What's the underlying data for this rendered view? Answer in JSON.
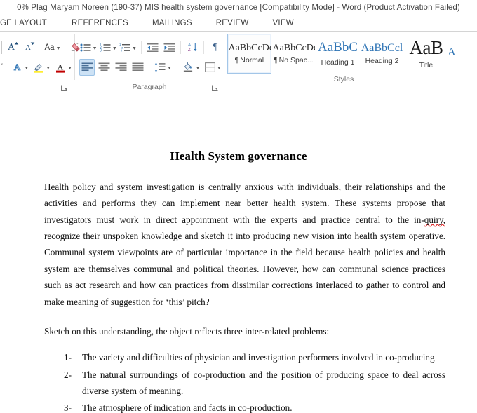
{
  "titlebar": {
    "text": "0% Plag Maryam Noreen (190-37) MIS health system governance [Compatibility Mode] - Word (Product Activation Failed)"
  },
  "tabs": [
    {
      "label": "GE LAYOUT",
      "name": "tab-page-layout"
    },
    {
      "label": "REFERENCES",
      "name": "tab-references"
    },
    {
      "label": "MAILINGS",
      "name": "tab-mailings"
    },
    {
      "label": "REVIEW",
      "name": "tab-review"
    },
    {
      "label": "VIEW",
      "name": "tab-view"
    }
  ],
  "ribbon": {
    "font_group": {
      "label": "",
      "buttons": [
        {
          "name": "grow-font-button",
          "tooltip": "Grow Font"
        },
        {
          "name": "shrink-font-button",
          "tooltip": "Shrink Font"
        },
        {
          "name": "change-case-button",
          "label": "Aa"
        },
        {
          "name": "clear-formatting-button",
          "tooltip": "Clear All Formatting"
        },
        {
          "name": "text-effects-button",
          "tooltip": "Text Effects and Typography"
        },
        {
          "name": "text-highlight-color-button",
          "tooltip": "Text Highlight Color"
        },
        {
          "name": "font-color-button",
          "tooltip": "Font Color"
        }
      ]
    },
    "paragraph_group": {
      "label": "Paragraph",
      "buttons": [
        {
          "name": "bullets-button",
          "tooltip": "Bullets"
        },
        {
          "name": "numbering-button",
          "tooltip": "Numbering"
        },
        {
          "name": "multilevel-list-button",
          "tooltip": "Multilevel List"
        },
        {
          "name": "decrease-indent-button",
          "tooltip": "Decrease Indent"
        },
        {
          "name": "increase-indent-button",
          "tooltip": "Increase Indent"
        },
        {
          "name": "sort-button",
          "tooltip": "Sort"
        },
        {
          "name": "show-hide-marks-button",
          "label": "¶"
        },
        {
          "name": "align-left-button",
          "tooltip": "Align Left",
          "active": true
        },
        {
          "name": "align-center-button",
          "tooltip": "Center"
        },
        {
          "name": "align-right-button",
          "tooltip": "Align Right"
        },
        {
          "name": "justify-button",
          "tooltip": "Justify"
        },
        {
          "name": "line-spacing-button",
          "tooltip": "Line and Paragraph Spacing"
        },
        {
          "name": "shading-button",
          "tooltip": "Shading"
        },
        {
          "name": "borders-button",
          "tooltip": "Borders"
        }
      ]
    },
    "styles_group": {
      "label": "Styles",
      "items": [
        {
          "preview": "AaBbCcDc",
          "name": "Normal",
          "marker": "¶ ",
          "selected": true,
          "kind": "normal"
        },
        {
          "preview": "AaBbCcDc",
          "name": "No Spac...",
          "marker": "¶ ",
          "selected": false,
          "kind": "normal"
        },
        {
          "preview": "AaBbC",
          "name": "Heading 1",
          "marker": "",
          "selected": false,
          "kind": "h1"
        },
        {
          "preview": "AaBbCcl",
          "name": "Heading 2",
          "marker": "",
          "selected": false,
          "kind": "h2"
        },
        {
          "preview": "AaB",
          "name": "Title",
          "marker": "",
          "selected": false,
          "kind": "title"
        },
        {
          "preview": "A",
          "name": "",
          "marker": "",
          "selected": false,
          "kind": "partial"
        }
      ]
    }
  },
  "document": {
    "title": "Health System governance",
    "paragraph_1": {
      "part_a": "Health policy and system investigation is centrally anxious with individuals, their relationships and the activities and performs they can implement near better health system. These systems propose that investigators must work in direct appointment with the experts and practice central to the in-",
      "misspelled": "quiry,",
      "part_b": " recognize their unspoken knowledge and sketch it into producing new vision into health system operative. Communal system viewpoints are of particular importance in the field because health policies and health system are themselves communal and political theories. However, how can communal science practices such as act research and how can practices from dissimilar corrections interlaced to gather to control and make meaning of suggestion for ‘this’ pitch?"
    },
    "paragraph_2": "Sketch on this understanding, the object reflects three inter-related problems:",
    "list": [
      {
        "marker": "1-",
        "text": "The variety and difficulties of physician and investigation performers involved in co-producing"
      },
      {
        "marker": "2-",
        "text": "The natural surroundings of co-production and the position of producing space to deal across diverse system of meaning."
      },
      {
        "marker": "3-",
        "text": "The atmosphere of indication and facts in co-production."
      }
    ]
  },
  "colors": {
    "accent_blue": "#2e74b5",
    "icon_blue": "#1f4e79",
    "highlight_yellow": "#ffe800",
    "font_red": "#c00000",
    "selection_blue": "#cde2f5",
    "spell_error_red": "#e03030"
  }
}
